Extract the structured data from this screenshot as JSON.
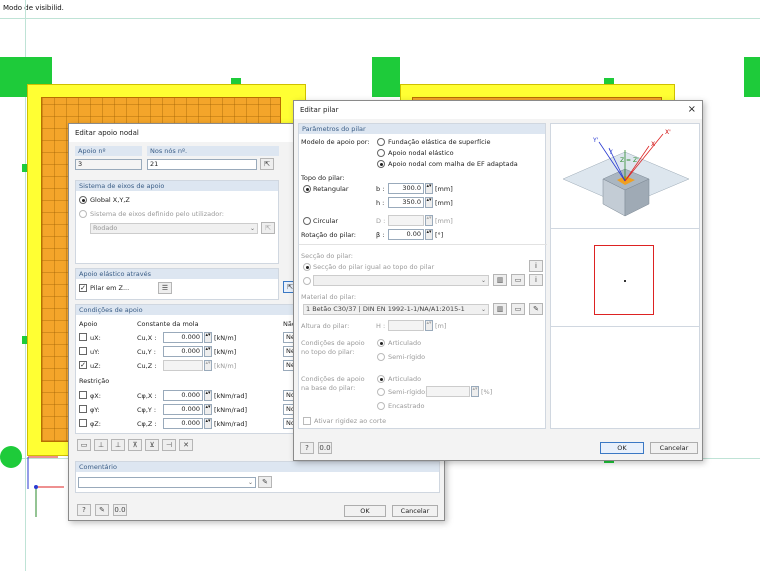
{
  "viewport": {
    "mode_text": "Modo de visibilid."
  },
  "nodal_dialog": {
    "title": "Editar apoio nodal",
    "support_no_label": "Apoio nº",
    "support_no": "3",
    "nodes_label": "Nos nós nº.",
    "nodes": "21",
    "axes_header": "Sistema de eixos de apoio",
    "axes_global": "Global X,Y,Z",
    "axes_user": "Sistema de eixos definido pelo utilizador:",
    "axes_user_select": "Rodado",
    "elastic_header": "Apoio elástico através",
    "column_checkbox": "Pilar em Z...",
    "conditions_header": "Condições de apoio",
    "col_support": "Apoio",
    "col_spring": "Constante da mola",
    "col_nonlinear": "Não",
    "translations": [
      {
        "label": "uX:",
        "const": "Cu,X :",
        "value": "0.000",
        "unit": "[kN/m]",
        "nl": "Ne",
        "checked": false
      },
      {
        "label": "uY:",
        "const": "Cu,Y :",
        "value": "0.000",
        "unit": "[kN/m]",
        "nl": "Ne",
        "checked": false
      },
      {
        "label": "uZ:",
        "const": "Cu,Z :",
        "value": "",
        "unit": "[kN/m]",
        "nl": "Ne",
        "checked": true
      }
    ],
    "restriction_label": "Restrição",
    "rotations": [
      {
        "label": "φX:",
        "const": "Cφ,X :",
        "value": "0.000",
        "unit": "[kNm/rad]",
        "nl": "No",
        "checked": false
      },
      {
        "label": "φY:",
        "const": "Cφ,Y :",
        "value": "0.000",
        "unit": "[kNm/rad]",
        "nl": "No",
        "checked": false
      },
      {
        "label": "φZ:",
        "const": "Cφ,Z :",
        "value": "0.000",
        "unit": "[kNm/rad]",
        "nl": "No",
        "checked": false
      }
    ],
    "comment_header": "Comentário",
    "comment_value": "",
    "ok": "OK",
    "cancel": "Cancelar"
  },
  "pilar_dialog": {
    "title": "Editar pilar",
    "params_header": "Parâmetros do pilar",
    "model_label": "Modelo de apoio por:",
    "model_options": [
      "Fundação elástica de superfície",
      "Apoio nodal elástico",
      "Apoio nodal com malha de EF adaptada"
    ],
    "top_label": "Topo do pilar:",
    "rect_label": "Retangular",
    "b_label": "b :",
    "b_value": "300.0",
    "h_label": "h :",
    "h_value": "350.0",
    "unit_mm": "[mm]",
    "circ_label": "Circular",
    "d_label": "D :",
    "rot_label": "Rotação do pilar:",
    "beta_label": "β :",
    "beta_value": "0.00",
    "unit_deg": "[°]",
    "section_label": "Secção do pilar:",
    "section_same": "Secção do pilar igual ao topo do pilar",
    "material_label": "Material do pilar:",
    "material_value": "1 Betão C30/37 | DIN EN 1992-1-1/NA/A1:2015-1",
    "height_label": "Altura do pilar:",
    "height_sym": "H :",
    "unit_m": "[m]",
    "top_cond_label": "Condições de apoio no topo do pilar:",
    "articulated": "Articulado",
    "semi_rigid": "Semi-rígido",
    "base_cond_label": "Condições de apoio na base do pilar:",
    "semi_rigid_colon": "Semi-rígido:",
    "unit_pct": "[%]",
    "embedded": "Encastrado",
    "activate_rigidity": "Ativar rigidez ao corte",
    "ok": "OK",
    "cancel": "Cancelar",
    "preview_axes": [
      "X'",
      "Y'",
      "X",
      "Y",
      "Z = Z'"
    ]
  },
  "colors": {
    "support_green": "#1ecb3a",
    "slab_yellow": "#ffff33",
    "slab_orange": "#f4a52a",
    "accent": "#3a78c4"
  }
}
